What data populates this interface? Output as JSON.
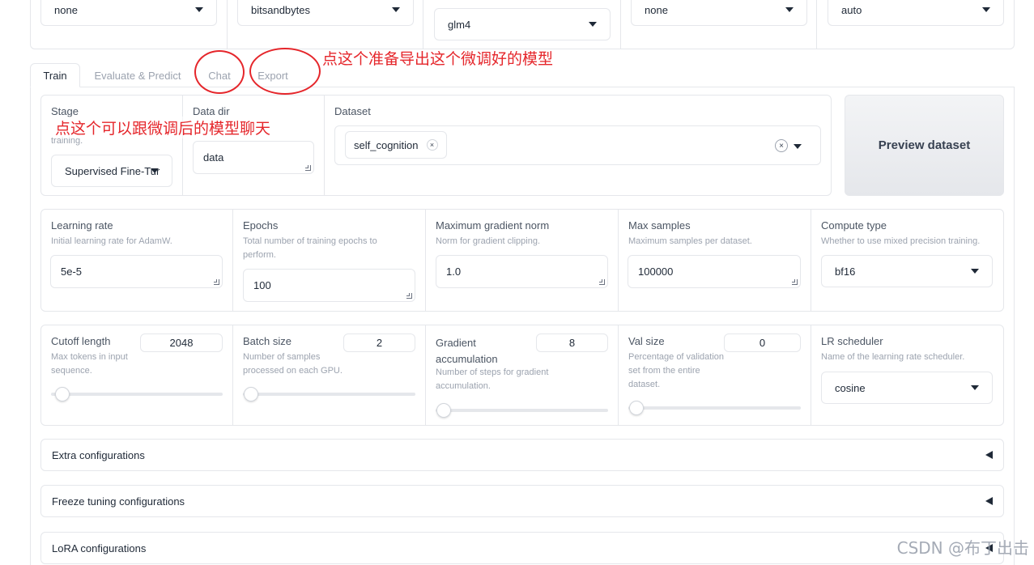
{
  "top_selects": [
    "none",
    "bitsandbytes",
    "glm4",
    "none",
    "auto"
  ],
  "tabs": [
    {
      "label": "Train",
      "active": true
    },
    {
      "label": "Evaluate & Predict",
      "active": false
    },
    {
      "label": "Chat",
      "active": false
    },
    {
      "label": "Export",
      "active": false
    }
  ],
  "stage": {
    "label": "Stage",
    "info_tail": "training.",
    "value": "Supervised Fine-Tur"
  },
  "data_dir": {
    "label": "Data dir",
    "value": "data"
  },
  "dataset": {
    "label": "Dataset",
    "chip": "self_cognition",
    "chip_remove": "×",
    "clear": "×"
  },
  "preview_label": "Preview dataset",
  "learning_rate": {
    "label": "Learning rate",
    "info": "Initial learning rate for AdamW.",
    "value": "5e-5"
  },
  "epochs": {
    "label": "Epochs",
    "info": "Total number of training epochs to perform.",
    "value": "100"
  },
  "max_grad_norm": {
    "label": "Maximum gradient norm",
    "info": "Norm for gradient clipping.",
    "value": "1.0"
  },
  "max_samples": {
    "label": "Max samples",
    "info": "Maximum samples per dataset.",
    "value": "100000"
  },
  "compute_type": {
    "label": "Compute type",
    "info": "Whether to use mixed precision training.",
    "value": "bf16"
  },
  "cutoff_len": {
    "label": "Cutoff length",
    "info": "Max tokens in input sequence.",
    "value": "2048",
    "slider_fraction": 0.01
  },
  "batch_size": {
    "label": "Batch size",
    "info": "Number of samples processed on each GPU.",
    "value": "2",
    "slider_fraction": 0.0
  },
  "grad_accum": {
    "label": "Gradient accumulation",
    "info": "Number of steps for gradient accumulation.",
    "value": "8",
    "slider_fraction": 0.0
  },
  "val_size": {
    "label": "Val size",
    "info": "Percentage of validation set from the entire dataset.",
    "value": "0",
    "slider_fraction": 0.0
  },
  "lr_scheduler": {
    "label": "LR scheduler",
    "info": "Name of the learning rate scheduler.",
    "value": "cosine"
  },
  "accordions": [
    "Extra configurations",
    "Freeze tuning configurations",
    "LoRA configurations"
  ],
  "annotations": {
    "export_note": "点这个准备导出这个微调好的模型",
    "chat_note": "点这个可以跟微调后的模型聊天"
  },
  "watermark": "CSDN @布丁出击",
  "colors": {
    "annotation": "#e5262b",
    "border": "#e5e7eb"
  }
}
